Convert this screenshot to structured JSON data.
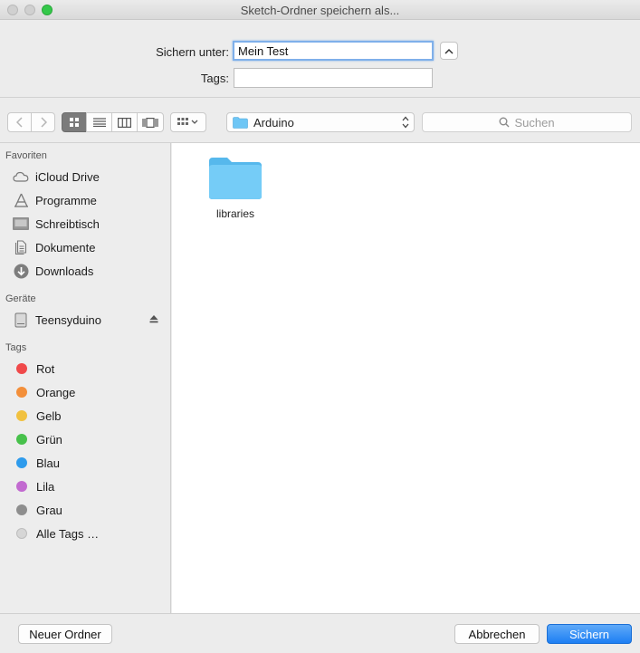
{
  "window": {
    "title": "Sketch-Ordner speichern als..."
  },
  "form": {
    "save_as_label": "Sichern unter:",
    "save_as_value": "Mein Test",
    "tags_label": "Tags:",
    "tags_value": ""
  },
  "toolbar": {
    "location": "Arduino",
    "search_placeholder": "Suchen"
  },
  "sidebar": {
    "favorites_header": "Favoriten",
    "favorites": [
      {
        "label": "iCloud Drive",
        "icon": "cloud-icon"
      },
      {
        "label": "Programme",
        "icon": "applications-icon"
      },
      {
        "label": "Schreibtisch",
        "icon": "desktop-icon"
      },
      {
        "label": "Dokumente",
        "icon": "documents-icon"
      },
      {
        "label": "Downloads",
        "icon": "downloads-icon"
      }
    ],
    "devices_header": "Geräte",
    "devices": [
      {
        "label": "Teensyduino",
        "icon": "drive-icon"
      }
    ],
    "tags_header": "Tags",
    "tags": [
      {
        "label": "Rot",
        "color": "#f0494a"
      },
      {
        "label": "Orange",
        "color": "#f38f3a"
      },
      {
        "label": "Gelb",
        "color": "#f1c13f"
      },
      {
        "label": "Grün",
        "color": "#47c14b"
      },
      {
        "label": "Blau",
        "color": "#2e9bec"
      },
      {
        "label": "Lila",
        "color": "#c26ad0"
      },
      {
        "label": "Grau",
        "color": "#8e8e8e"
      },
      {
        "label": "Alle Tags …",
        "color": "#d6d6d6"
      }
    ]
  },
  "content": {
    "items": [
      {
        "name": "libraries",
        "icon": "folder-icon"
      }
    ]
  },
  "footer": {
    "new_folder": "Neuer Ordner",
    "cancel": "Abbrechen",
    "save": "Sichern"
  },
  "colors": {
    "accent": "#1d7ff3",
    "folder": "#6ec6f5"
  }
}
